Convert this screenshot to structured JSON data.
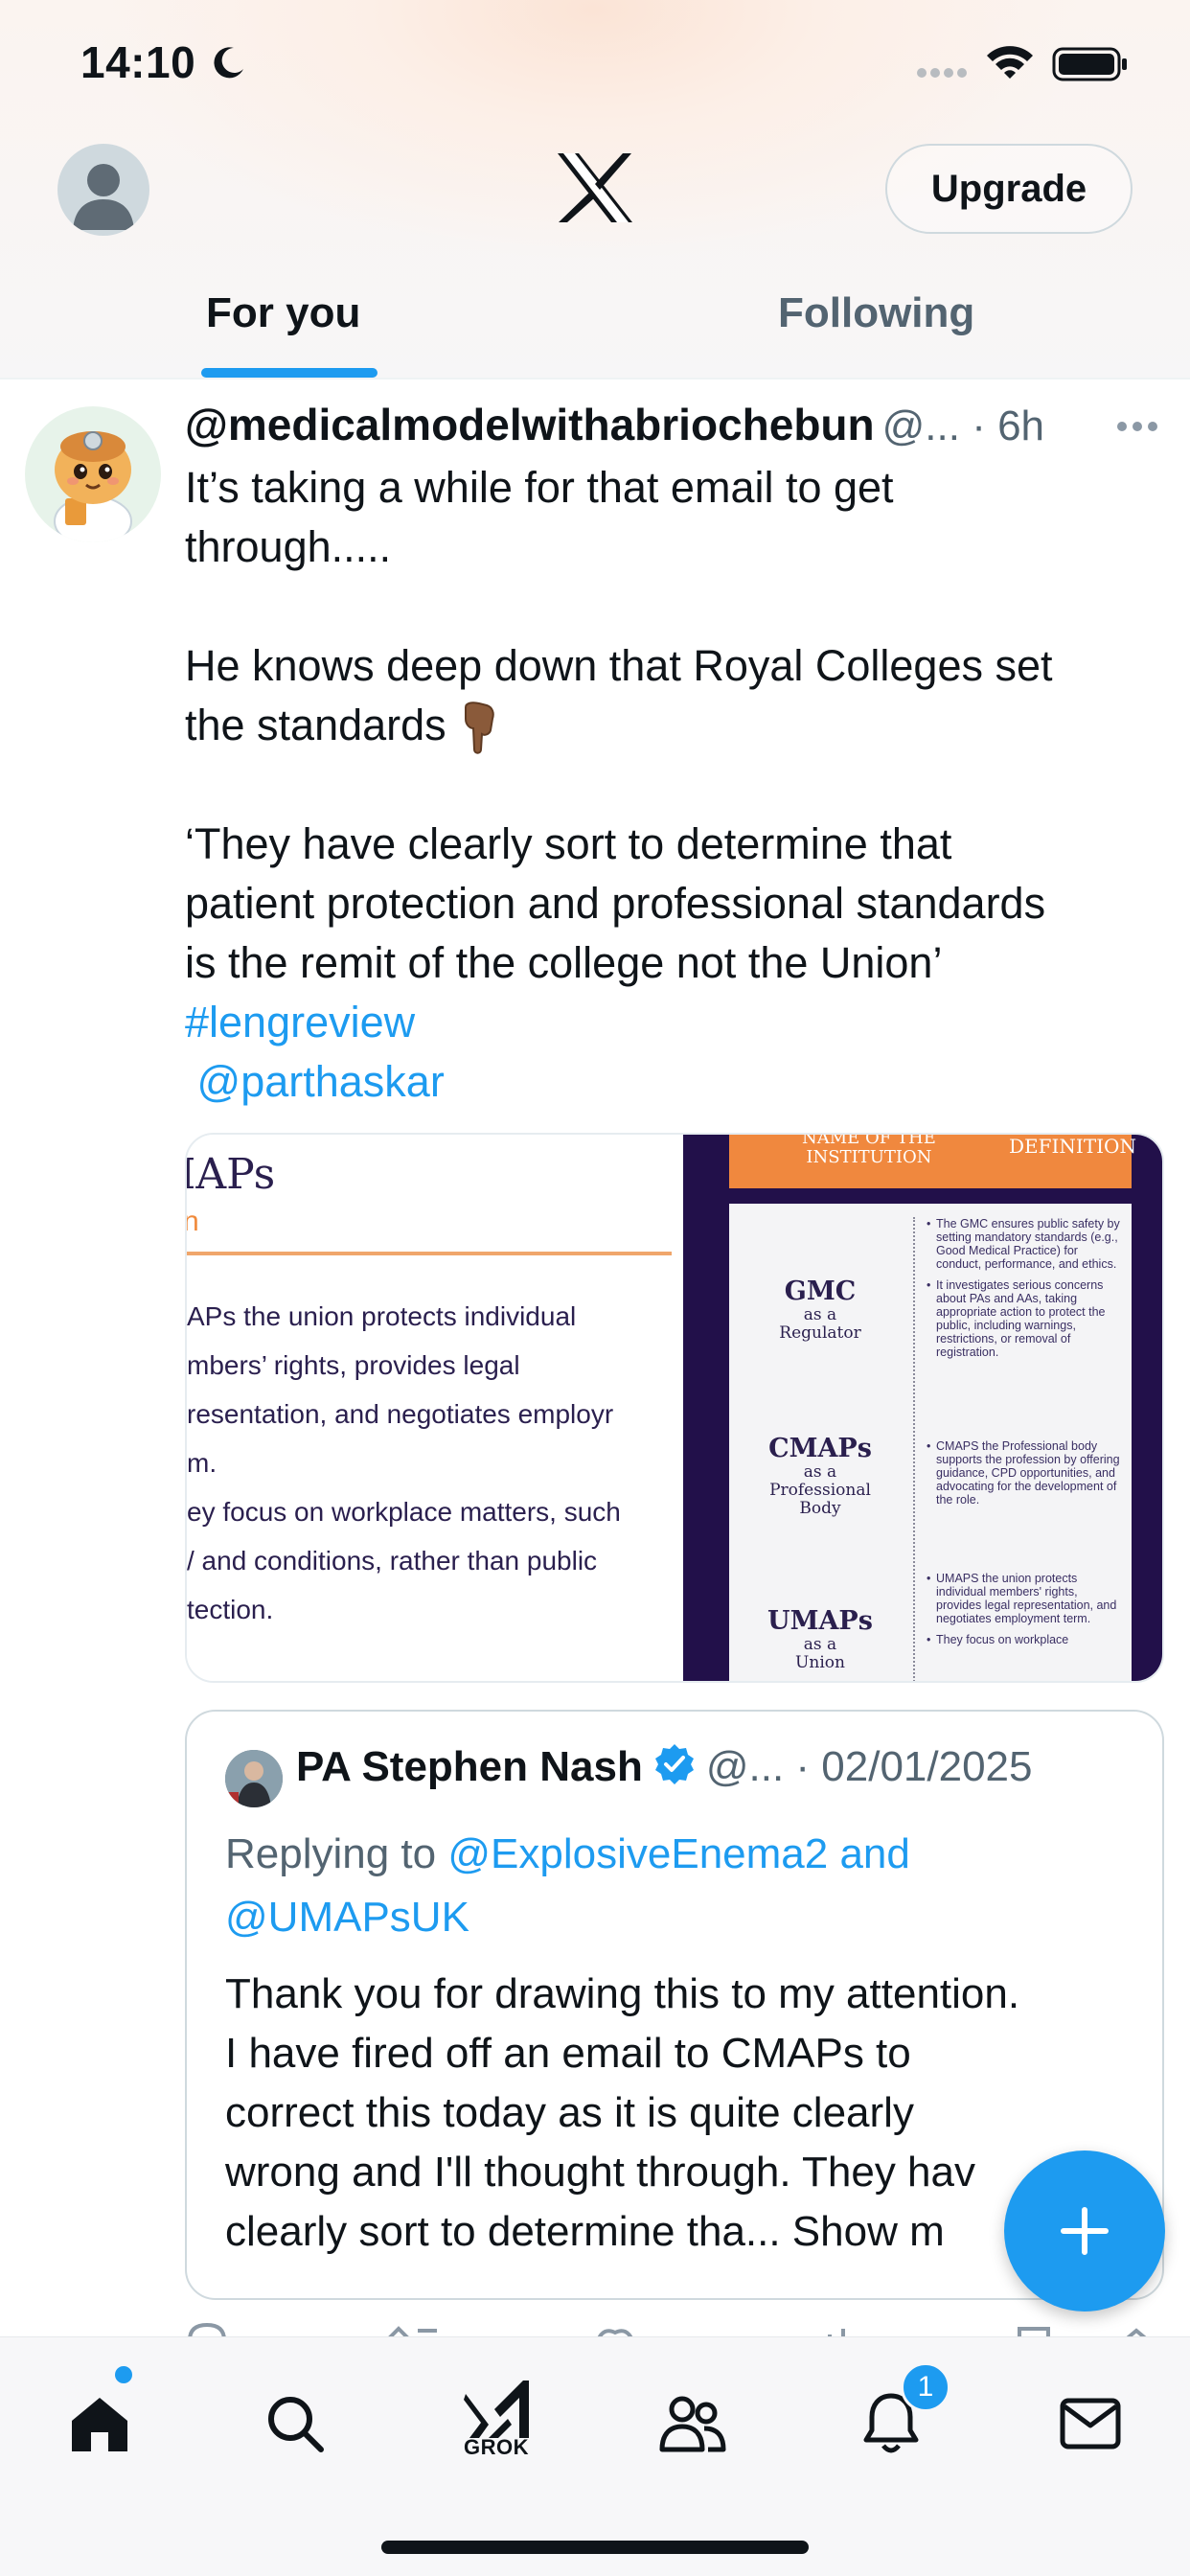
{
  "status_bar": {
    "time": "14:10"
  },
  "header": {
    "upgrade_label": "Upgrade"
  },
  "tabs": [
    {
      "label": "For you"
    },
    {
      "label": "Following"
    }
  ],
  "post": {
    "author_handle": "@medicalmodelwithabriochebun",
    "meta": "@... · 6h",
    "body": {
      "p1_line1": "It’s taking a while for that email to get",
      "p1_line2": "through.....",
      "p2_line1": "He knows deep down that Royal Colleges set",
      "p2_line2": "the standards",
      "p3_line1": "‘They have clearly sort to determine that",
      "p3_line2": "patient protection and professional standards",
      "p3_line3": "is the remit of the college not the Union’",
      "hashtag": "#lengreview",
      "mention": "@parthaskar"
    },
    "media": {
      "left_slide": {
        "title": "IAPs",
        "subtitle": "n",
        "lines": [
          "APs the union protects individual",
          "mbers’ rights, provides legal",
          "resentation, and negotiates employr",
          "m.",
          "ey focus on workplace matters, such",
          "/ and conditions, rather than public",
          "tection."
        ]
      },
      "right_slide": {
        "header_left_line1": "NAME OF THE",
        "header_left_line2": "INSTITUTION",
        "header_right": "DEFINITION",
        "rows": [
          {
            "name": "GMC",
            "role_line1": "as a",
            "role_line2": "Regulator",
            "role_line3": "",
            "bullets": [
              "The GMC ensures public safety by setting mandatory standards (e.g., Good Medical Practice) for conduct, performance, and ethics.",
              "It investigates serious concerns about PAs and AAs, taking appropriate action to protect the public, including warnings, restrictions, or removal of registration."
            ]
          },
          {
            "name": "CMAPs",
            "role_line1": "as a",
            "role_line2": "Professional",
            "role_line3": "Body",
            "bullets": [
              "CMAPS the Professional body supports the profession by offering guidance, CPD opportunities, and advocating for the development of the role."
            ]
          },
          {
            "name": "UMAPs",
            "role_line1": "as a",
            "role_line2": "Union",
            "role_line3": "",
            "bullets": [
              "UMAPS the union protects individual members' rights, provides legal representation, and negotiates employment term.",
              "They focus on workplace"
            ]
          }
        ]
      }
    }
  },
  "quoted_post": {
    "author_name": "PA Stephen Nash",
    "meta": "@... · 02/01/2025",
    "replying_prefix": "Replying to",
    "replying_to_line1": "@ExplosiveEnema2 and",
    "replying_to_line2": "@UMAPsUK",
    "text_lines": [
      "Thank you for drawing this to my attention.",
      "I have fired off an email to CMAPs to",
      "correct this today as it is quite clearly",
      "wrong and I'll thought through. They hav",
      "clearly sort to determine tha... Show m"
    ]
  },
  "bottom_nav": {
    "grok_label": "GROK",
    "notifications_count": "1"
  },
  "colors": {
    "accent": "#1d9bf0",
    "text_primary": "#0f1419",
    "text_secondary": "#536471",
    "slide_dark": "#22104a",
    "slide_orange": "#f0883e"
  },
  "icons": {
    "status": [
      "moon-icon",
      "signal-icon",
      "wifi-icon",
      "battery-icon"
    ],
    "header": [
      "profile-avatar",
      "x-logo-icon"
    ],
    "post": [
      "more-icon",
      "pointing-down-emoji",
      "verified-badge-icon"
    ],
    "nav": [
      "home-icon",
      "search-icon",
      "grok-icon",
      "communities-icon",
      "bell-icon",
      "mail-icon"
    ],
    "compose": "plus-icon"
  }
}
